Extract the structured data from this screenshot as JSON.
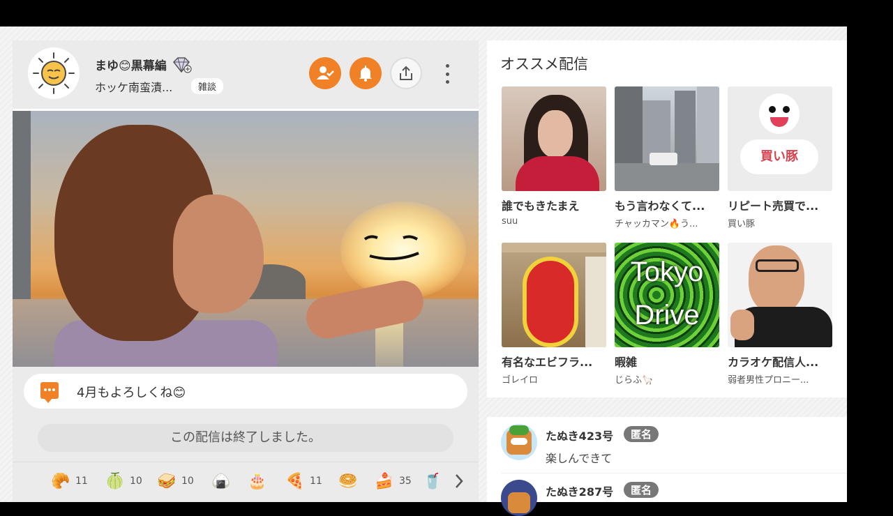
{
  "streamer": {
    "name": "まゆ😊黒幕編",
    "stream_title": "ホッケ南蛮漬...",
    "tag": "雑談"
  },
  "last_comment": "4月もよろしくね😊",
  "ended_notice": "この配信は終了しました。",
  "gifts": [
    {
      "icon": "croissant",
      "glyph": "🥐",
      "count": "11"
    },
    {
      "icon": "melon-bread",
      "glyph": "🍈",
      "count": "10"
    },
    {
      "icon": "sandwich",
      "glyph": "🥪",
      "count": "10"
    },
    {
      "icon": "onigiri-face",
      "glyph": "🍙",
      "count": ""
    },
    {
      "icon": "cake-face",
      "glyph": "🎂",
      "count": ""
    },
    {
      "icon": "pizza",
      "glyph": "🍕",
      "count": "11"
    },
    {
      "icon": "bun-face",
      "glyph": "🥯",
      "count": ""
    },
    {
      "icon": "cake-slice",
      "glyph": "🍰",
      "count": "35"
    },
    {
      "icon": "drink",
      "glyph": "🥤",
      "count": ""
    }
  ],
  "recommendations": {
    "heading": "オススメ配信",
    "items": [
      {
        "title": "誰でもきたまえ",
        "user": "suu"
      },
      {
        "title": "もう言わなくて...",
        "user": "チャッカマン🔥う..."
      },
      {
        "title": "リピート売買で...",
        "user": "買い豚"
      },
      {
        "title": "有名なエビフラ...",
        "user": "ゴレイロ"
      },
      {
        "title": "暇雑",
        "user": "じらふ🦙"
      },
      {
        "title": "カラオケ配信人...",
        "user": "弱者男性プロニー..."
      }
    ],
    "thumb_text": {
      "pig_label": "買い豚",
      "tokyo": "Tokyo",
      "drive": "Drive"
    }
  },
  "comments": [
    {
      "name": "たぬき423号",
      "badge": "匿名",
      "message": "楽しんできて"
    },
    {
      "name": "たぬき287号",
      "badge": "匿名",
      "message": ""
    }
  ],
  "colors": {
    "accent": "#f08126",
    "badge_gray": "#777777"
  }
}
